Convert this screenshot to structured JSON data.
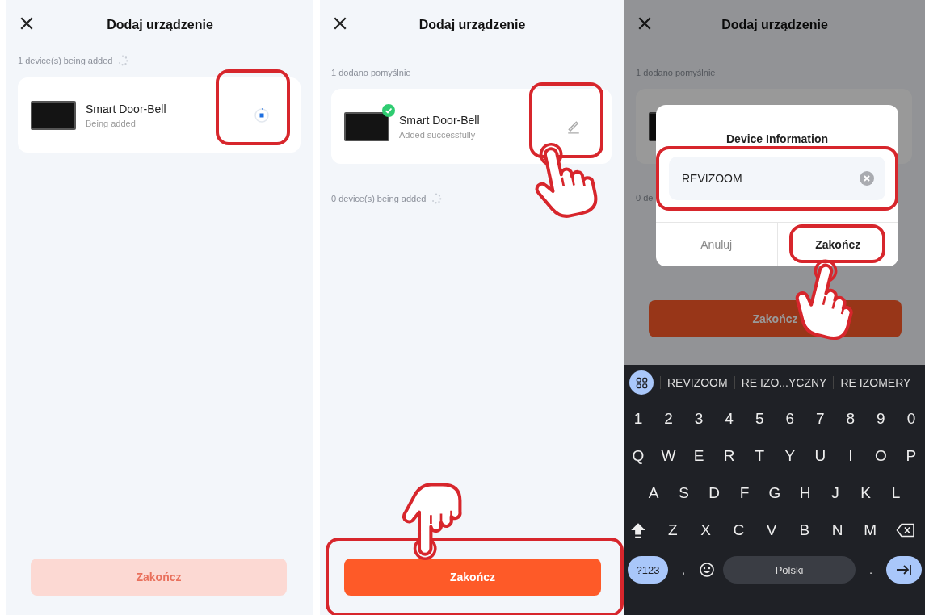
{
  "screens": [
    {
      "title": "Dodaj urządzenie",
      "header_label": "1 device(s) being added",
      "header_spinner": true,
      "device": {
        "name": "Smart Door-Bell",
        "status": "Being added",
        "added": false,
        "highlighted": true,
        "tapped": false
      },
      "finish": {
        "label": "Zakończ",
        "disabled": true,
        "highlighted": false,
        "tapped": false
      }
    },
    {
      "title": "Dodaj urządzenie",
      "header_label": "1 dodano pomyślnie",
      "header_spinner": false,
      "device": {
        "name": "Smart Door-Bell",
        "status": "Added successfully",
        "added": true,
        "highlighted": true,
        "tapped": true
      },
      "footer_label": "0 device(s) being added",
      "footer_spinner": true,
      "finish": {
        "label": "Zakończ",
        "disabled": false,
        "highlighted": true,
        "tapped": true
      }
    },
    {
      "title": "Dodaj urządzenie",
      "header_label": "1 dodano pomyślnie",
      "header_spinner": false,
      "footer_label": "0 de",
      "finish": {
        "label": "Zakończ",
        "disabled": false,
        "highlighted": false,
        "tapped": false
      },
      "dialog": {
        "title": "Device Information",
        "value": "REVIZOOM",
        "field_highlighted": true,
        "buttons": [
          {
            "label": "Anuluj",
            "primary": false,
            "highlighted": false,
            "tapped": false
          },
          {
            "label": "Zakończ",
            "primary": true,
            "highlighted": true,
            "tapped": true
          }
        ]
      },
      "keyboard": {
        "suggestions": [
          "REVIZOOM",
          "RE IZO...YCZNY",
          "RE IZOMERY"
        ],
        "rows": [
          [
            "1",
            "2",
            "3",
            "4",
            "5",
            "6",
            "7",
            "8",
            "9",
            "0"
          ],
          [
            "Q",
            "W",
            "E",
            "R",
            "T",
            "Y",
            "U",
            "I",
            "O",
            "P"
          ],
          [
            "A",
            "S",
            "D",
            "F",
            "G",
            "H",
            "J",
            "K",
            "L"
          ],
          [
            "Z",
            "X",
            "C",
            "V",
            "B",
            "N",
            "M"
          ]
        ],
        "symbols_key": "?123",
        "comma_key": ",",
        "space_key": "Polski",
        "period_key": "."
      }
    }
  ]
}
